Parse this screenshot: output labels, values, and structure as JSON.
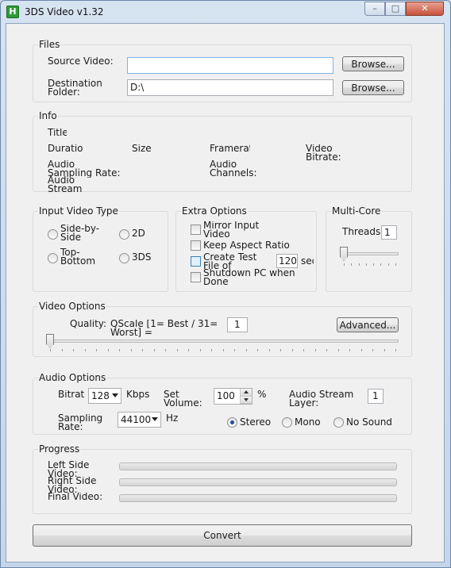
{
  "window": {
    "title": "3DS Video v1.32",
    "icon_letter": "H",
    "minimize": "–",
    "maximize": "□",
    "close": "✕"
  },
  "files": {
    "group": "Files",
    "source_label": "Source Video:",
    "source_value": "",
    "dest_label": "Destination Folder:",
    "dest_value": "D:\\",
    "browse": "Browse..."
  },
  "info": {
    "group": "Info",
    "title": "Title",
    "duration": "Duration",
    "size": "Size",
    "framerate": "Framerate",
    "video_bitrate": "Video Bitrate:",
    "audio_sampling": "Audio Sampling Rate:",
    "audio_channels": "Audio Channels:",
    "audio_stream": "Audio Stream Layer:"
  },
  "input_type": {
    "group": "Input Video Type",
    "side_by_side": "Side-by-Side",
    "top_bottom": "Top-Bottom",
    "two_d": "2D",
    "three_ds": "3DS"
  },
  "extra": {
    "group": "Extra Options",
    "mirror": "Mirror Input Video",
    "aspect": "Keep Aspect Ratio",
    "test_file": "Create Test File of",
    "test_seconds": "120",
    "test_unit": "sec",
    "shutdown": "Shutdown PC when Done"
  },
  "multicore": {
    "group": "Multi-Core",
    "threads_label": "Threads:",
    "threads_value": "1",
    "slider_level": 0
  },
  "video": {
    "group": "Video Options",
    "quality_label": "Quality:",
    "qscale_label": "QScale [1= Best / 31= Worst] =",
    "qscale_value": "1",
    "advanced": "Advanced...",
    "slider_level": 0
  },
  "audio": {
    "group": "Audio Options",
    "bitrate_label": "Bitrate:",
    "bitrate_value": "128",
    "kbps": "Kbps",
    "volume_label": "Set Volume:",
    "volume_value": "100",
    "percent": "%",
    "stream_label": "Audio Stream Layer:",
    "stream_value": "1",
    "sampling_label": "Sampling Rate:",
    "sampling_value": "44100",
    "hz": "Hz",
    "stereo": "Stereo",
    "mono": "Mono",
    "no_sound": "No Sound"
  },
  "progress": {
    "group": "Progress",
    "left": "Left Side Video:",
    "right": "Right Side Video:",
    "final": "Final Video:",
    "left_value": 0,
    "right_value": 0,
    "final_value": 0
  },
  "convert": "Convert"
}
